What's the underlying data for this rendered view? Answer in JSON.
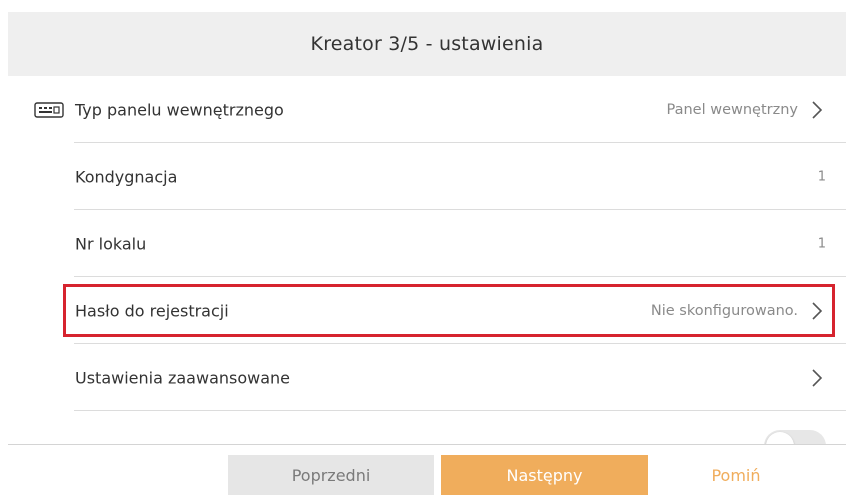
{
  "header": {
    "title": "Kreator 3/5 - ustawienia"
  },
  "rows": [
    {
      "label": "Typ panelu wewnętrznego",
      "value": "Panel wewnętrzny",
      "icon": "keyboard-icon",
      "has_chevron": true
    },
    {
      "label": "Kondygnacja",
      "value": "1",
      "has_chevron": false
    },
    {
      "label": "Nr lokalu",
      "value": "1",
      "has_chevron": false
    },
    {
      "label": "Hasło do rejestracji",
      "value": "Nie skonfigurowano.",
      "has_chevron": true,
      "highlighted": true
    },
    {
      "label": "Ustawienia zaawansowane",
      "value": "",
      "has_chevron": true
    }
  ],
  "footer": {
    "prev_label": "Poprzedni",
    "next_label": "Następny",
    "skip_label": "Pomiń"
  },
  "colors": {
    "header_bg": "#efefef",
    "accent": "#f0ad5c",
    "highlight": "#d6232e",
    "prev_bg": "#e6e6e6"
  }
}
